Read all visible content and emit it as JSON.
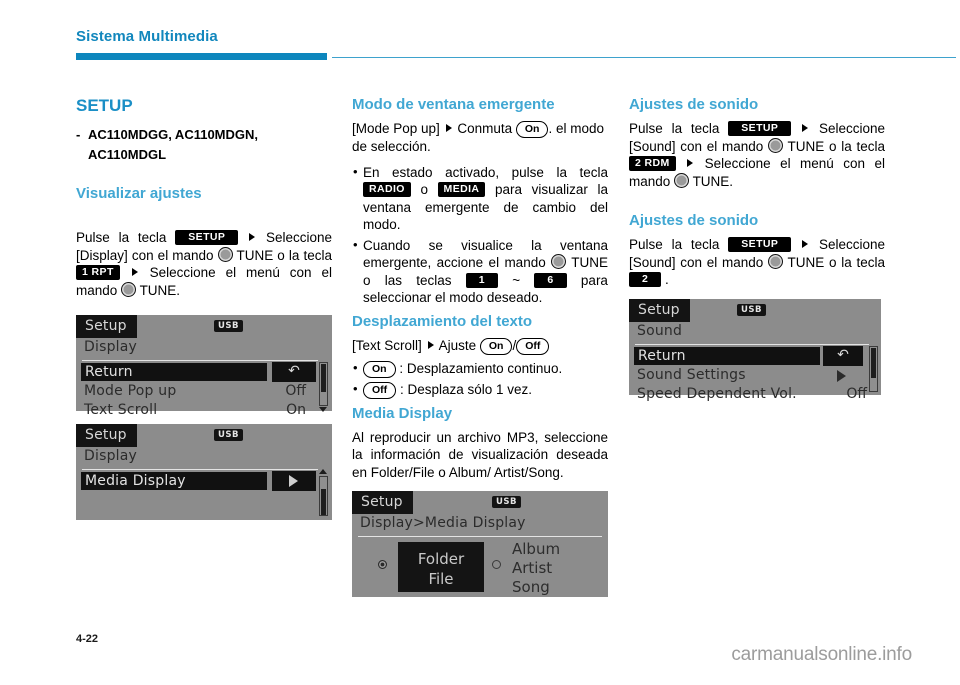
{
  "header": {
    "chapter_title": "Sistema Multimedia",
    "accent_color": "#0d86bd"
  },
  "footer": {
    "page_number": "4-22",
    "watermark": "carmanualsonline.info"
  },
  "columns": {
    "left": {
      "heading": "SETUP",
      "model_line_1": "AC110MDGG, AC110MDGN,",
      "model_line_2": "AC110MDGL",
      "dash": "-",
      "sub_heading": "Visualizar ajustes",
      "para_1a": "Pulse la tecla",
      "key_setup": "SETUP",
      "para_1b": "Seleccione [Display] con el mando",
      "para_1c": "TUNE o la tecla",
      "key_1rpt": "1 RPT",
      "para_1d": "Seleccione el menú con el mando",
      "para_1e": "TUNE."
    },
    "middle": {
      "heading_popup": "Modo de ventana emergente",
      "popup_1a": "[Mode Pop up]",
      "popup_1b": "Conmuta",
      "pill_on": "On",
      "popup_1c": ". el modo de selección.",
      "bullet_1a": "En estado activado, pulse la tecla",
      "key_radio": "RADIO",
      "bullet_1b": "o",
      "key_media": "MEDIA",
      "bullet_1c": "para visualizar la ventana emergente de cambio del modo.",
      "bullet_2a": "Cuando se visualice la ventana emergente, accione el mando",
      "bullet_2b": "TUNE o las teclas",
      "key_1": "1",
      "bullet_2c": "~",
      "key_6": "6",
      "bullet_2d": "para seleccionar el modo deseado.",
      "heading_scroll": "Desplazamiento del texto",
      "scroll_1a": "[Text Scroll]",
      "scroll_1b": "Ajuste",
      "pill_on2": "On",
      "pill_slash": "/",
      "pill_off2": "Off",
      "scroll_b1_pill": "On",
      "scroll_b1_text": ": Desplazamiento continuo.",
      "scroll_b2_pill": "Off",
      "scroll_b2_text": ": Desplaza sólo 1 vez.",
      "heading_media": "Media Display",
      "media_para": "Al reproducir un archivo MP3, seleccione la información de visualización deseada en Folder/File o Album/ Artist/Song."
    },
    "right": {
      "heading_1": "Ajustes de sonido",
      "r1_a": "Pulse la tecla",
      "key_setup": "SETUP",
      "r1_b": "Seleccione [Sound] con el mando",
      "r1_c": "TUNE o la tecla",
      "key_2rdm": "2 RDM",
      "r1_d": "Seleccione el menú con el mando",
      "r1_e": "TUNE.",
      "heading_2": "Ajustes de sonido",
      "r2_a": "Pulse la tecla",
      "key_setup2": "SETUP",
      "r2_b": "Seleccione [Sound] con el mando",
      "r2_c": "TUNE o la tecla",
      "key_2": "2",
      "r2_d": "."
    }
  },
  "screens": {
    "setup_display_1": {
      "tab": "Setup",
      "badge": "USB",
      "breadcrumb": "Display",
      "rows": [
        {
          "label": "Return",
          "value": "",
          "selected": true,
          "value_icon": "return-arrow"
        },
        {
          "label": "Mode Pop up",
          "value": "Off",
          "selected": false
        },
        {
          "label": "Text Scroll",
          "value": "On",
          "selected": false
        }
      ]
    },
    "setup_display_2": {
      "tab": "Setup",
      "badge": "USB",
      "breadcrumb": "Display",
      "rows": [
        {
          "label": "Media Display",
          "value": "",
          "selected": true,
          "value_icon": "play-arrow"
        }
      ]
    },
    "media_display": {
      "tab": "Setup",
      "badge": "USB",
      "breadcrumb": "Display>Media Display",
      "option_left_line1": "Folder",
      "option_left_line2": "File",
      "option_right_line1": "Album",
      "option_right_line2": "Artist",
      "option_right_line3": "Song",
      "left_selected": true
    },
    "setup_sound": {
      "tab": "Setup",
      "badge": "USB",
      "breadcrumb": "Sound",
      "rows": [
        {
          "label": "Return",
          "value": "",
          "selected": true,
          "value_icon": "return-arrow"
        },
        {
          "label": "Sound Settings",
          "value": "",
          "selected": false,
          "value_icon": "play-arrow"
        },
        {
          "label": "Speed Dependent Vol.",
          "value": "Off",
          "selected": false
        }
      ]
    }
  }
}
